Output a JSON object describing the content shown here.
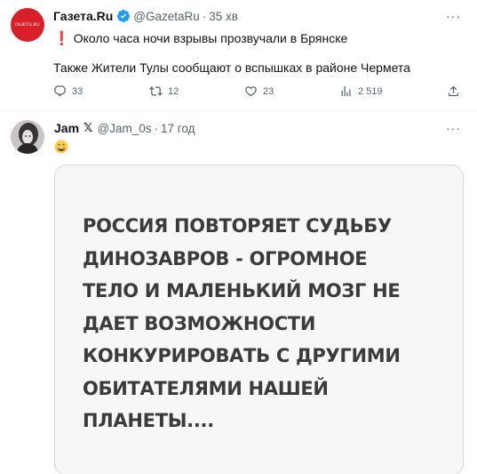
{
  "tweet1": {
    "avatar_text": "ГАЗЕТА.RU",
    "author_name": "Газета.Ru",
    "handle": "@GazetaRu",
    "separator": "·",
    "time": "35 хв",
    "more": "···",
    "text_line1_icon": "❗",
    "text_line1": "Около часа ночи взрывы прозвучали в Брянске",
    "text_line2": "Также Жители Тулы сообщают о вспышках в районе Чермета",
    "actions": {
      "replies": "33",
      "retweets": "12",
      "likes": "23",
      "views": "2 519"
    },
    "icons": {
      "verified": "verified-badge-icon",
      "reply": "reply-icon",
      "retweet": "retweet-icon",
      "like": "heart-icon",
      "views": "views-chart-icon",
      "share": "share-icon"
    },
    "colors": {
      "avatar_bg": "#d8202a",
      "verified": "#1d9bf0"
    }
  },
  "tweet2": {
    "author_name": "Jam",
    "badge": "𝕏",
    "handle": "@Jam_0s",
    "separator": "·",
    "time": "17 год",
    "more": "···",
    "emoji_icon": "grinning-face-emoji",
    "card_lines": [
      "РОССИЯ ПОВТОРЯЕТ СУДЬБУ",
      "ДИНОЗАВРОВ - ОГРОМНОЕ",
      "ТЕЛО И МАЛЕНЬКИЙ МОЗГ НЕ",
      "ДАЕТ ВОЗМОЖНОСТИ",
      "КОНКУРИРОВАТЬ С ДРУГИМИ",
      "ОБИТАТЕЛЯМИ НАШЕЙ",
      "ПЛАНЕТЫ...."
    ]
  }
}
